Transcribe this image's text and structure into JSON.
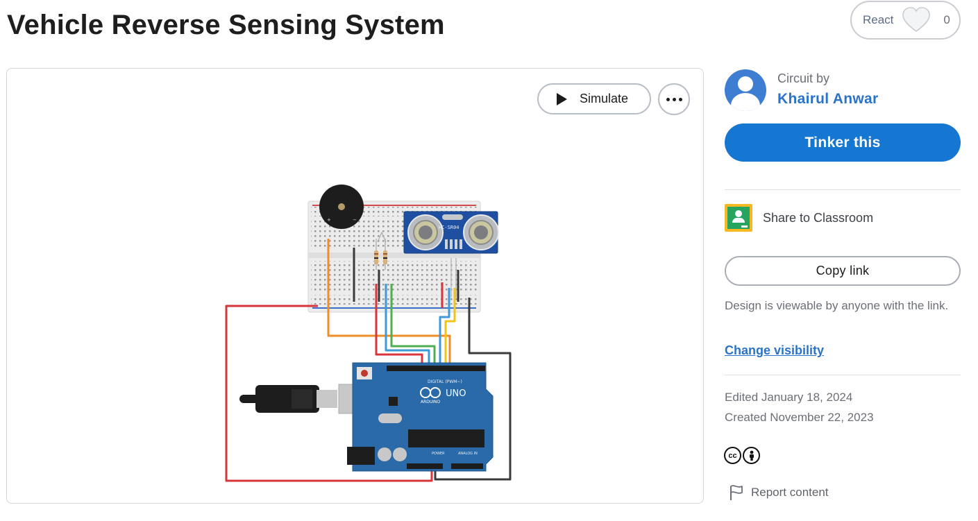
{
  "page": {
    "title": "Vehicle Reverse Sensing System"
  },
  "react": {
    "label": "React",
    "count": "0"
  },
  "viewer": {
    "simulate_label": "Simulate",
    "components": {
      "sensor_label": "HC-SR04",
      "board_brand": "ARDUINO",
      "board_model": "UNO",
      "header_digital": "DIGITAL (PWM~)",
      "header_power": "POWER",
      "header_analog": "ANALOG IN"
    }
  },
  "author": {
    "prefix": "Circuit by",
    "name": "Khairul Anwar"
  },
  "actions": {
    "tinker_label": "Tinker this",
    "classroom_label": "Share to Classroom",
    "copy_link_label": "Copy link",
    "visibility_note": "Design is viewable by anyone with the link.",
    "change_visibility_label": "Change visibility"
  },
  "meta": {
    "edited": "Edited January 18, 2024",
    "created": "Created November 22, 2023"
  },
  "license": {
    "cc": "cc",
    "by": "BY"
  },
  "report": {
    "label": "Report content"
  },
  "colors": {
    "primary": "#1677d2",
    "link": "#2b73c8",
    "muted": "#6b6f76",
    "arduino_blue": "#2a6aa8",
    "wire_red": "#d8353a",
    "wire_orange": "#ef8c2a",
    "wire_blue": "#3b9ad8",
    "wire_green": "#4fae52",
    "wire_yellow": "#f0c419",
    "wire_black": "#3a3a3a"
  }
}
